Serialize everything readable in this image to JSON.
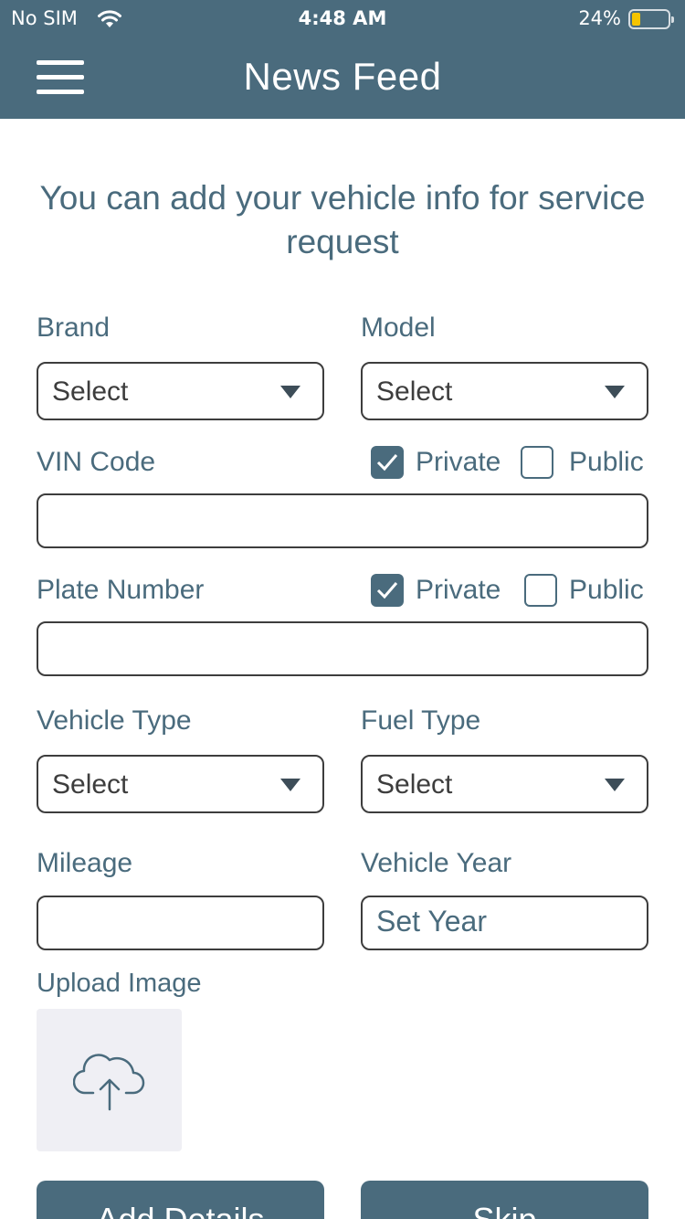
{
  "status_bar": {
    "carrier": "No SIM",
    "time": "4:48 AM",
    "battery_percent": "24%",
    "battery_level": 0.24,
    "icons": [
      "wifi-icon",
      "battery-icon"
    ]
  },
  "nav": {
    "title": "News Feed",
    "menu_icon": "hamburger-menu-icon"
  },
  "intro_text": "You can add your vehicle info for service request",
  "form": {
    "brand": {
      "label": "Brand",
      "value": "Select"
    },
    "model": {
      "label": "Model",
      "value": "Select"
    },
    "vin": {
      "label": "VIN Code",
      "value": "",
      "private_label": "Private",
      "public_label": "Public",
      "private_checked": true,
      "public_checked": false
    },
    "plate": {
      "label": "Plate Number",
      "value": "",
      "private_label": "Private",
      "public_label": "Public",
      "private_checked": true,
      "public_checked": false
    },
    "vehicle_type": {
      "label": "Vehicle Type",
      "value": "Select"
    },
    "fuel_type": {
      "label": "Fuel Type",
      "value": "Select"
    },
    "mileage": {
      "label": "Mileage",
      "value": ""
    },
    "vehicle_year": {
      "label": "Vehicle Year",
      "placeholder": "Set Year"
    },
    "upload": {
      "label": "Upload Image",
      "icon": "cloud-upload-icon"
    }
  },
  "buttons": {
    "add_details": "Add Details",
    "skip": "Skip"
  },
  "colors": {
    "primary": "#4a6b7d",
    "upload_bg": "#efeff4",
    "battery": "#f5c400"
  }
}
